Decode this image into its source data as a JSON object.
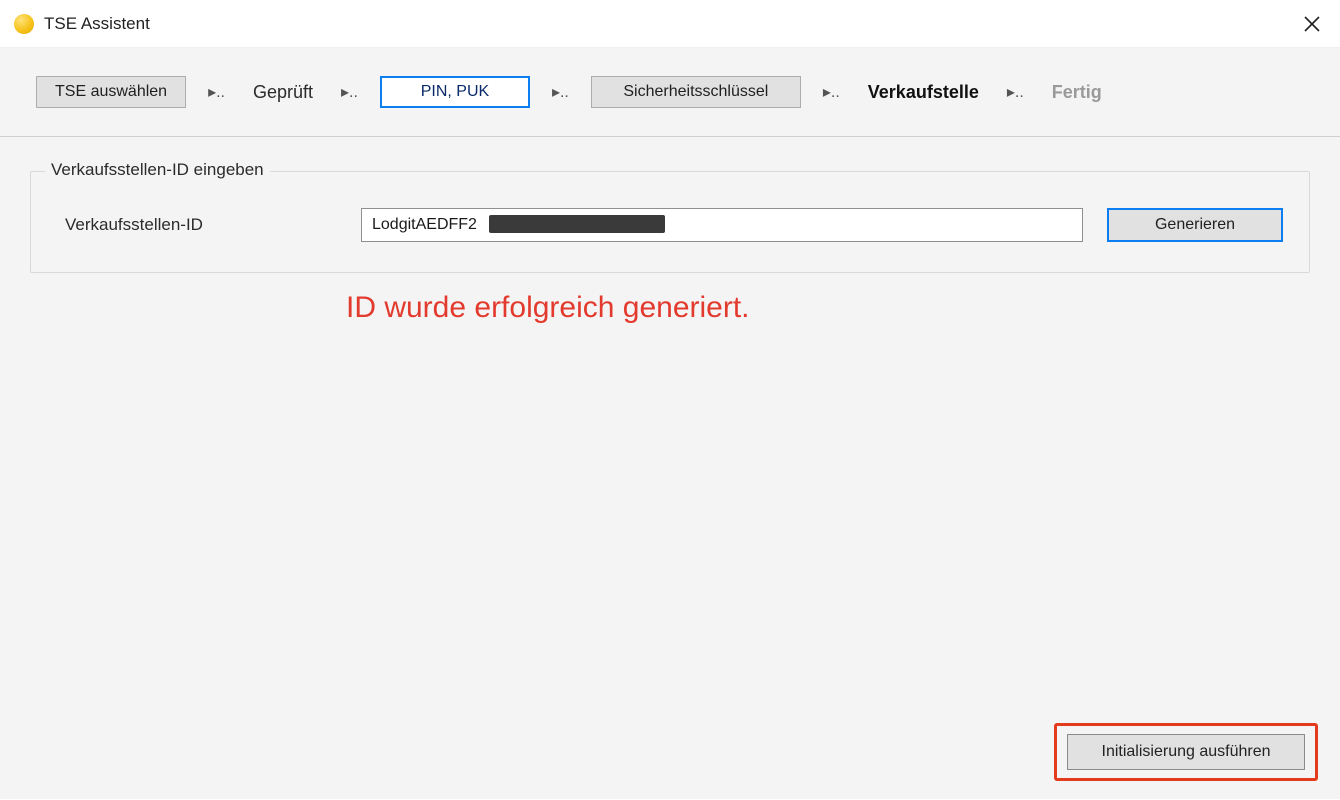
{
  "window": {
    "title": "TSE Assistent"
  },
  "steps": {
    "select": "TSE auswählen",
    "checked": "Geprüft",
    "pinpuk": "PIN, PUK",
    "seckey": "Sicherheitsschlüssel",
    "pointofsale": "Verkaufstelle",
    "done": "Fertig"
  },
  "group": {
    "title": "Verkaufsstellen-ID eingeben",
    "label": "Verkaufsstellen-ID",
    "value": "LodgitAEDFF2",
    "generate": "Generieren"
  },
  "status": "ID wurde erfolgreich generiert.",
  "footer": {
    "initialize": "Initialisierung ausführen"
  }
}
